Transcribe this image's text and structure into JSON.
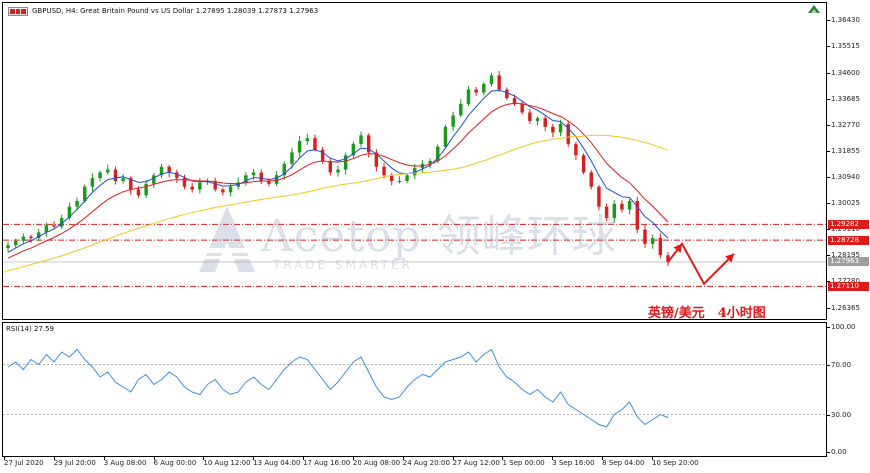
{
  "header": {
    "symbol_info": "GBPUSD, H4:  Great Britain Pound vs US Dollar  1.27895 1.28039 1.27873 1.27963"
  },
  "annotation": "英镑/美元　4小时图",
  "watermark": {
    "name": "Acetop 领峰环球",
    "tagline": "TRADE SMARTER"
  },
  "colors": {
    "bull": "#1a9a1a",
    "bear": "#d62020",
    "ma_fast": "#1f4fd8",
    "ma_mid": "#e31a1c",
    "ma_slow": "#f2c81a",
    "level_line": "#e0191b",
    "arrow": "#e0191b",
    "rsi_line": "#3b8fe0"
  },
  "chart_data": [
    {
      "type": "candlestick",
      "title": "GBPUSD, H4",
      "subtitle": "Great Britain Pound vs US Dollar",
      "ohlc_last": {
        "open": 1.27895,
        "high": 1.28039,
        "low": 1.27873,
        "close": 1.27963
      },
      "ylim": [
        1.26,
        1.37
      ],
      "y_ticks": [
        "1.36430",
        "1.35515",
        "1.34600",
        "1.33685",
        "1.32770",
        "1.31855",
        "1.30940",
        "1.30025",
        "1.29110",
        "1.28195",
        "1.27280",
        "1.26365"
      ],
      "x_ticks": [
        "27 Jul 2020",
        "29 Jul 20:00",
        "3 Aug 08:00",
        "6 Aug 00:00",
        "10 Aug 12:00",
        "13 Aug 04:00",
        "17 Aug 16:00",
        "20 Aug 08:00",
        "24 Aug 20:00",
        "27 Aug 12:00",
        "1 Sep 00:00",
        "3 Sep 16:00",
        "8 Sep 04:00",
        "10 Sep 20:00"
      ],
      "close_series": [
        1.2855,
        1.287,
        1.2885,
        1.288,
        1.29,
        1.2925,
        1.292,
        1.295,
        1.299,
        1.301,
        1.306,
        1.309,
        1.311,
        1.312,
        1.308,
        1.309,
        1.305,
        1.303,
        1.307,
        1.31,
        1.313,
        1.311,
        1.309,
        1.306,
        1.305,
        1.3075,
        1.308,
        1.305,
        1.304,
        1.306,
        1.3075,
        1.31,
        1.311,
        1.308,
        1.307,
        1.31,
        1.314,
        1.318,
        1.322,
        1.323,
        1.319,
        1.315,
        1.311,
        1.312,
        1.317,
        1.321,
        1.324,
        1.318,
        1.313,
        1.31,
        1.308,
        1.308,
        1.31,
        1.3125,
        1.314,
        1.315,
        1.32,
        1.327,
        1.331,
        1.335,
        1.34,
        1.339,
        1.342,
        1.345,
        1.34,
        1.337,
        1.335,
        1.332,
        1.329,
        1.33,
        1.327,
        1.325,
        1.328,
        1.321,
        1.317,
        1.311,
        1.306,
        1.299,
        1.295,
        1.3,
        1.298,
        1.301,
        1.291,
        1.286,
        1.288,
        1.282,
        1.2796
      ],
      "moving_averages": [
        {
          "values": [
            1.283,
            1.2845,
            1.286,
            1.287,
            1.2885,
            1.29,
            1.2912,
            1.293,
            1.2955,
            1.298,
            1.301,
            1.304,
            1.3065,
            1.3085,
            1.309,
            1.3095,
            1.3085,
            1.3075,
            1.3078,
            1.309,
            1.3105,
            1.311,
            1.3105,
            1.3092,
            1.308,
            1.3078,
            1.3078,
            1.307,
            1.3062,
            1.3063,
            1.3068,
            1.308,
            1.3092,
            1.309,
            1.3085,
            1.309,
            1.3105,
            1.313,
            1.316,
            1.3185,
            1.319,
            1.318,
            1.316,
            1.315,
            1.3158,
            1.3175,
            1.3195,
            1.3192,
            1.3175,
            1.315,
            1.3125,
            1.3108,
            1.3105,
            1.311,
            1.3122,
            1.3135,
            1.316,
            1.3195,
            1.3235,
            1.327,
            1.331,
            1.334,
            1.337,
            1.3395,
            1.3398,
            1.339,
            1.3378,
            1.336,
            1.334,
            1.3328,
            1.331,
            1.3292,
            1.3288,
            1.3265,
            1.3235,
            1.3195,
            1.315,
            1.31,
            1.3055,
            1.304,
            1.3025,
            1.3022,
            1.299,
            1.2955,
            1.2935,
            1.2905,
            1.288
          ]
        },
        {
          "values": [
            1.281,
            1.2822,
            1.2835,
            1.2845,
            1.2858,
            1.287,
            1.2882,
            1.2896,
            1.2912,
            1.293,
            1.295,
            1.2972,
            1.2995,
            1.3015,
            1.303,
            1.3042,
            1.305,
            1.3055,
            1.306,
            1.3068,
            1.3076,
            1.3082,
            1.3085,
            1.3084,
            1.3082,
            1.308,
            1.308,
            1.3077,
            1.3073,
            1.3071,
            1.3071,
            1.3074,
            1.3078,
            1.308,
            1.308,
            1.3082,
            1.309,
            1.3102,
            1.3118,
            1.3135,
            1.3146,
            1.315,
            1.3148,
            1.3146,
            1.315,
            1.3158,
            1.317,
            1.3176,
            1.3174,
            1.3166,
            1.3155,
            1.3144,
            1.3136,
            1.3132,
            1.3133,
            1.3138,
            1.315,
            1.3168,
            1.3192,
            1.3218,
            1.3248,
            1.3272,
            1.3298,
            1.3322,
            1.3338,
            1.3348,
            1.3352,
            1.335,
            1.3344,
            1.3338,
            1.3328,
            1.3316,
            1.3306,
            1.329,
            1.327,
            1.3244,
            1.3214,
            1.3178,
            1.3142,
            1.3116,
            1.3092,
            1.3074,
            1.3046,
            1.3016,
            1.2992,
            1.2964,
            1.2936
          ]
        },
        {
          "values": [
            1.276,
            1.2768,
            1.2776,
            1.2784,
            1.2792,
            1.28,
            1.2808,
            1.2817,
            1.2826,
            1.2836,
            1.2846,
            1.2857,
            1.2868,
            1.2879,
            1.289,
            1.29,
            1.291,
            1.2919,
            1.2928,
            1.2937,
            1.2946,
            1.2954,
            1.2962,
            1.2969,
            1.2976,
            1.2982,
            1.2988,
            1.2993,
            1.2998,
            1.3003,
            1.3008,
            1.3013,
            1.3018,
            1.3022,
            1.3026,
            1.303,
            1.3035,
            1.3041,
            1.3048,
            1.3055,
            1.3061,
            1.3066,
            1.307,
            1.3074,
            1.3079,
            1.3085,
            1.3092,
            1.3098,
            1.3102,
            1.3105,
            1.3107,
            1.3109,
            1.3111,
            1.3114,
            1.3118,
            1.3122,
            1.3128,
            1.3136,
            1.3145,
            1.3155,
            1.3166,
            1.3176,
            1.3187,
            1.3198,
            1.3207,
            1.3215,
            1.3221,
            1.3226,
            1.323,
            1.3234,
            1.3236,
            1.3238,
            1.324,
            1.324,
            1.3238,
            1.3235,
            1.323,
            1.3224,
            1.3216,
            1.3208,
            1.3198,
            1.3188
          ]
        }
      ],
      "horizontal_levels": [
        "1.29282",
        "1.28728",
        "1.27110"
      ],
      "current_price": "1.27963"
    },
    {
      "type": "line",
      "title": "RSI(14) 27.59",
      "ylim": [
        0,
        100
      ],
      "y_ticks": [
        "100.00",
        "70.00",
        "30.00",
        "0.00"
      ],
      "reference_levels": [
        70,
        30
      ],
      "values": [
        68,
        72,
        66,
        74,
        70,
        78,
        72,
        80,
        76,
        82,
        74,
        68,
        60,
        64,
        56,
        52,
        48,
        58,
        62,
        54,
        58,
        64,
        60,
        52,
        48,
        46,
        54,
        58,
        50,
        46,
        48,
        56,
        60,
        54,
        50,
        58,
        66,
        72,
        76,
        74,
        66,
        58,
        50,
        56,
        64,
        72,
        76,
        64,
        52,
        44,
        42,
        44,
        52,
        58,
        62,
        60,
        66,
        72,
        74,
        76,
        80,
        72,
        78,
        82,
        68,
        60,
        56,
        50,
        46,
        50,
        44,
        40,
        48,
        38,
        34,
        30,
        26,
        22,
        20,
        30,
        34,
        40,
        28,
        22,
        26,
        30,
        27.59
      ]
    }
  ]
}
